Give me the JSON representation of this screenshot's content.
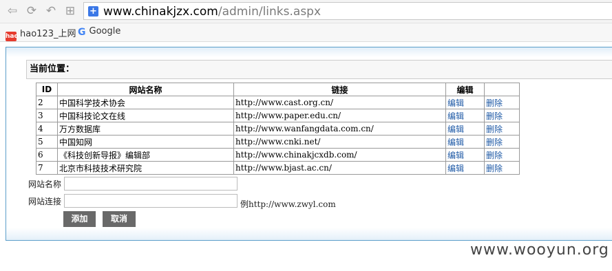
{
  "browser": {
    "url_domain": "www.chinakjzx.com",
    "url_path": "/admin/links.aspx",
    "bookmarks": [
      {
        "label": "hao123_上网",
        "icon": "hao123-icon"
      },
      {
        "label": "Google",
        "icon": "google-icon"
      }
    ]
  },
  "page": {
    "location_label": "当前位置：",
    "table": {
      "headers": [
        "ID",
        "网站名称",
        "链接",
        "编辑",
        ""
      ],
      "rows": [
        {
          "id": "2",
          "name": "中国科学技术协会",
          "url": "http://www.cast.org.cn/",
          "edit": "编辑",
          "delete": "删除"
        },
        {
          "id": "3",
          "name": "中国科技论文在线",
          "url": "http://www.paper.edu.cn/",
          "edit": "编辑",
          "delete": "删除"
        },
        {
          "id": "4",
          "name": "万方数据库",
          "url": "http://www.wanfangdata.com.cn/",
          "edit": "编辑",
          "delete": "删除"
        },
        {
          "id": "5",
          "name": "中国知网",
          "url": "http://www.cnki.net/",
          "edit": "编辑",
          "delete": "删除"
        },
        {
          "id": "6",
          "name": "《科技创新导报》编辑部",
          "url": "http://www.chinakjcxdb.com/",
          "edit": "编辑",
          "delete": "删除"
        },
        {
          "id": "7",
          "name": "北京市科技技术研究院",
          "url": "http://www.bjast.ac.cn/",
          "edit": "编辑",
          "delete": "删除"
        }
      ]
    },
    "form": {
      "name_label": "网站名称",
      "name_value": "",
      "url_label": "网站连接",
      "url_value": "",
      "url_example": "例http://www.zwyl.com",
      "add_button": "添加",
      "cancel_button": "取消"
    }
  },
  "watermark": "www.wooyun.org",
  "colors": {
    "accent_border": "#5b9ec9",
    "link": "#1f5aa6",
    "button": "#696969"
  }
}
